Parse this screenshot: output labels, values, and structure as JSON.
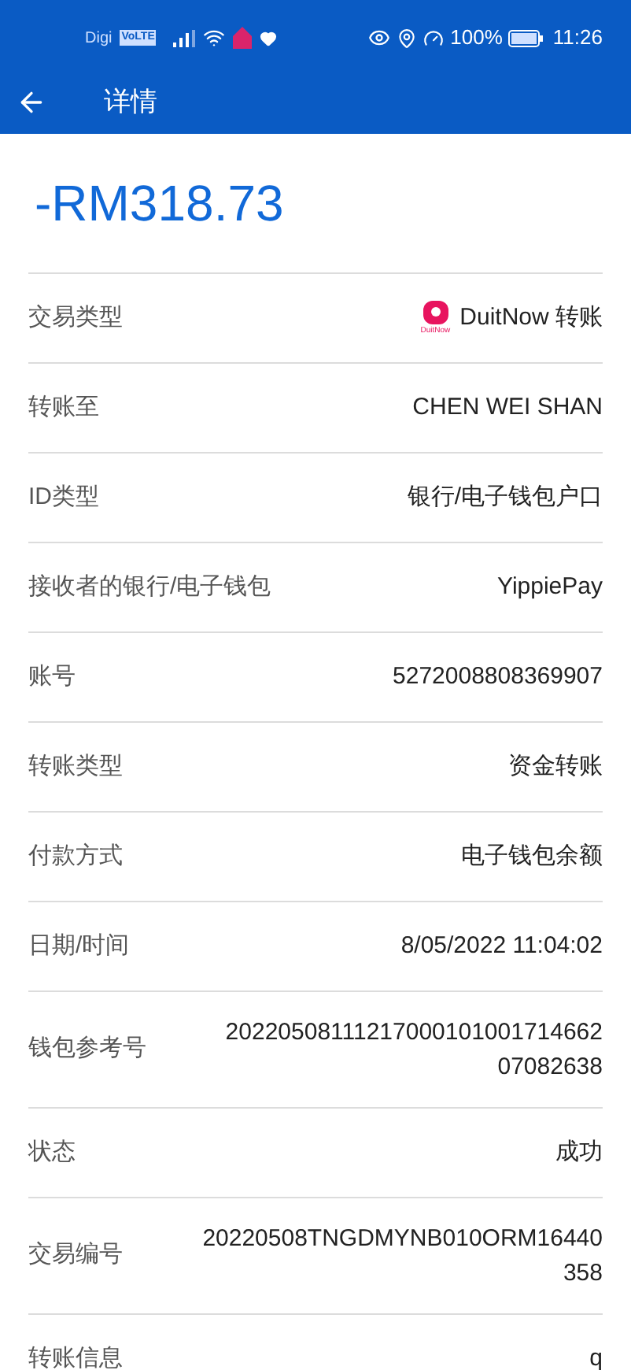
{
  "status_bar": {
    "carrier": "Digi",
    "volte": "VoLTE",
    "battery": "100%",
    "time": "11:26"
  },
  "header": {
    "title": "详情"
  },
  "amount": "-RM318.73",
  "rows": [
    {
      "label": "交易类型",
      "value": [
        "DuitNow 转账"
      ],
      "logo": "DuitNow"
    },
    {
      "label": "转账至",
      "value": [
        "CHEN WEI SHAN"
      ]
    },
    {
      "label": "ID类型",
      "value": [
        "银行/电子钱包户口"
      ]
    },
    {
      "label": "接收者的银行/电子钱包",
      "value": [
        "YippiePay"
      ]
    },
    {
      "label": "账号",
      "value": [
        "5272008808369907"
      ]
    },
    {
      "label": "转账类型",
      "value": [
        "资金转账"
      ]
    },
    {
      "label": "付款方式",
      "value": [
        "电子钱包余额"
      ]
    },
    {
      "label": "日期/时间",
      "value": [
        "8/05/2022 11:04:02"
      ]
    },
    {
      "label": "钱包参考号",
      "value": [
        "20220508111217000101001714662",
        "07082638"
      ]
    },
    {
      "label": "状态",
      "value": [
        "成功"
      ]
    },
    {
      "label": "交易编号",
      "value": [
        "20220508TNGDMYNB010ORM16440",
        "358"
      ]
    },
    {
      "label": "转账信息",
      "value": [
        "q"
      ]
    }
  ]
}
